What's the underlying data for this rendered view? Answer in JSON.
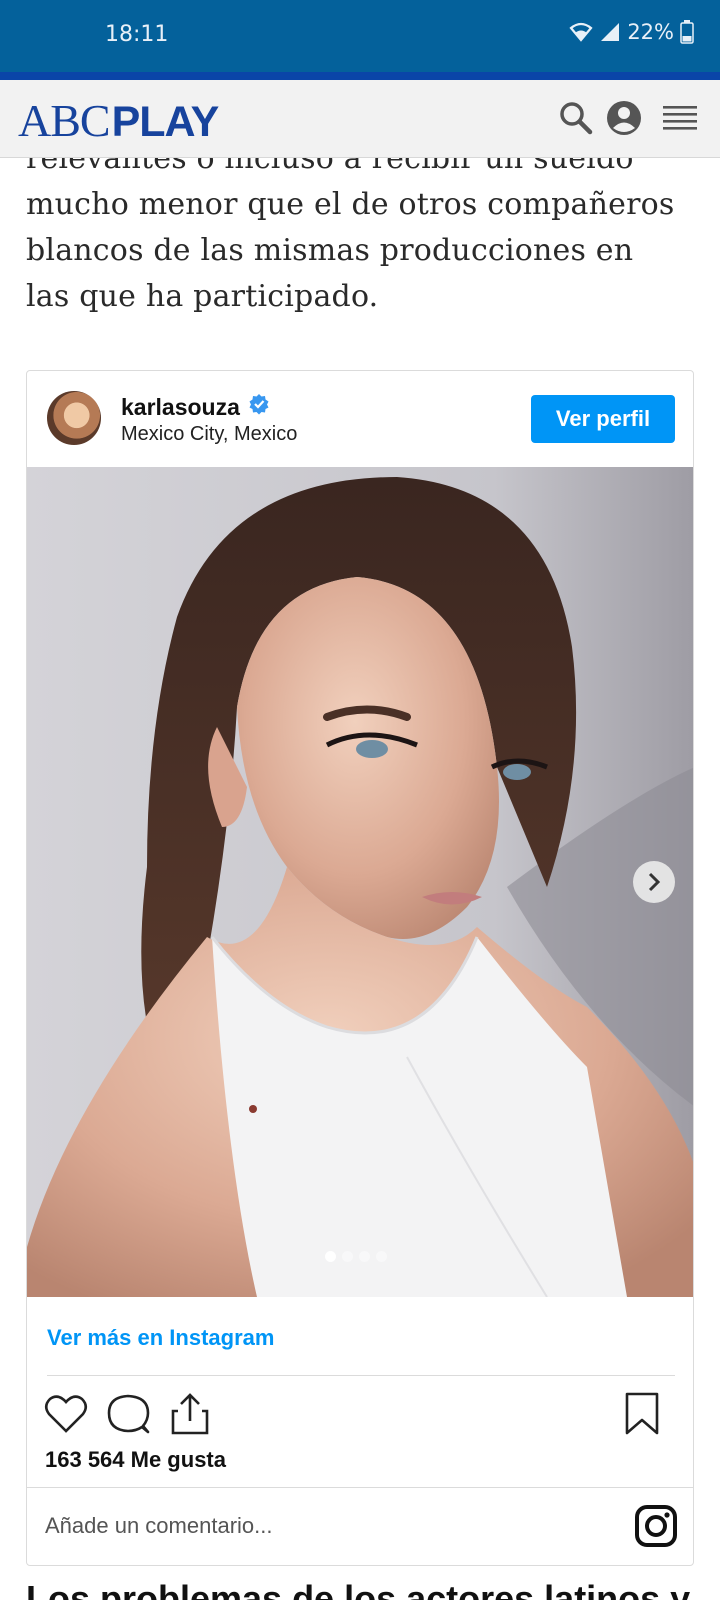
{
  "status_bar": {
    "time": "18:11",
    "battery": "22%",
    "icons": [
      "wifi-icon",
      "signal-icon",
      "battery-icon"
    ]
  },
  "header": {
    "logo_part1": "ABC",
    "logo_part2": "PLAY",
    "brand_color": "#17439d",
    "icons": [
      "search-icon",
      "account-icon",
      "menu-icon"
    ]
  },
  "article": {
    "lines": [
      "relevantes o incluso a recibir un sueldo",
      "mucho menor que el de otros compañeros",
      "blancos de las mismas producciones en",
      "las que ha participado."
    ],
    "next_heading": "Los problemas de los actores latinos y"
  },
  "instagram": {
    "username": "karlasouza",
    "location": "Mexico City, Mexico",
    "profile_button": "Ver perfil",
    "more_link": "Ver más en Instagram",
    "likes": "163 564 Me gusta",
    "comment_placeholder": "Añade un comentario...",
    "carousel": {
      "total": 4,
      "active": 1
    },
    "accent": "#0095f6"
  }
}
